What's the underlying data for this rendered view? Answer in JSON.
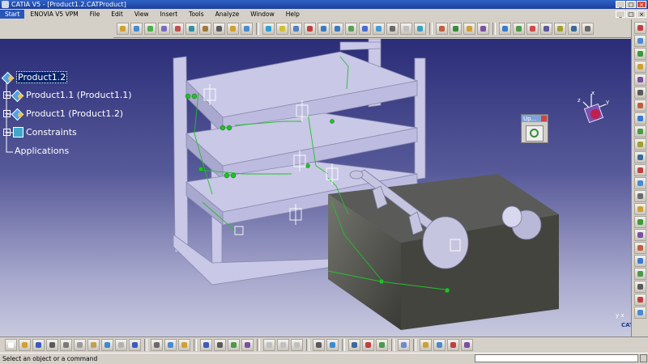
{
  "window": {
    "title": "CATIA V5 - [Product1.2.CATProduct]",
    "controls": [
      "_",
      "□",
      "×"
    ]
  },
  "menu": {
    "items": [
      "Start",
      "ENOVIA V5 VPM",
      "File",
      "Edit",
      "View",
      "Insert",
      "Tools",
      "Analyze",
      "Window",
      "Help"
    ]
  },
  "tree": {
    "root": "Product1.2",
    "children": [
      "Product1.1 (Product1.1)",
      "Product1 (Product1.2)",
      "Constraints"
    ],
    "applications": "Applications"
  },
  "floating_toolbar": {
    "title": "Up..."
  },
  "compass": {
    "x": "x",
    "y": "y",
    "z": "z"
  },
  "viewport_axes": {
    "y": "y",
    "x": "x"
  },
  "logo": "CATIA",
  "status": {
    "message": "Select an object or a command",
    "command_value": ""
  },
  "colors": {
    "viewport_top": "#2a2d77",
    "viewport_bottom": "#c8c9df",
    "frame": "#c9c8e6",
    "box": "#4a4a44",
    "constraint": "#22c02a"
  }
}
